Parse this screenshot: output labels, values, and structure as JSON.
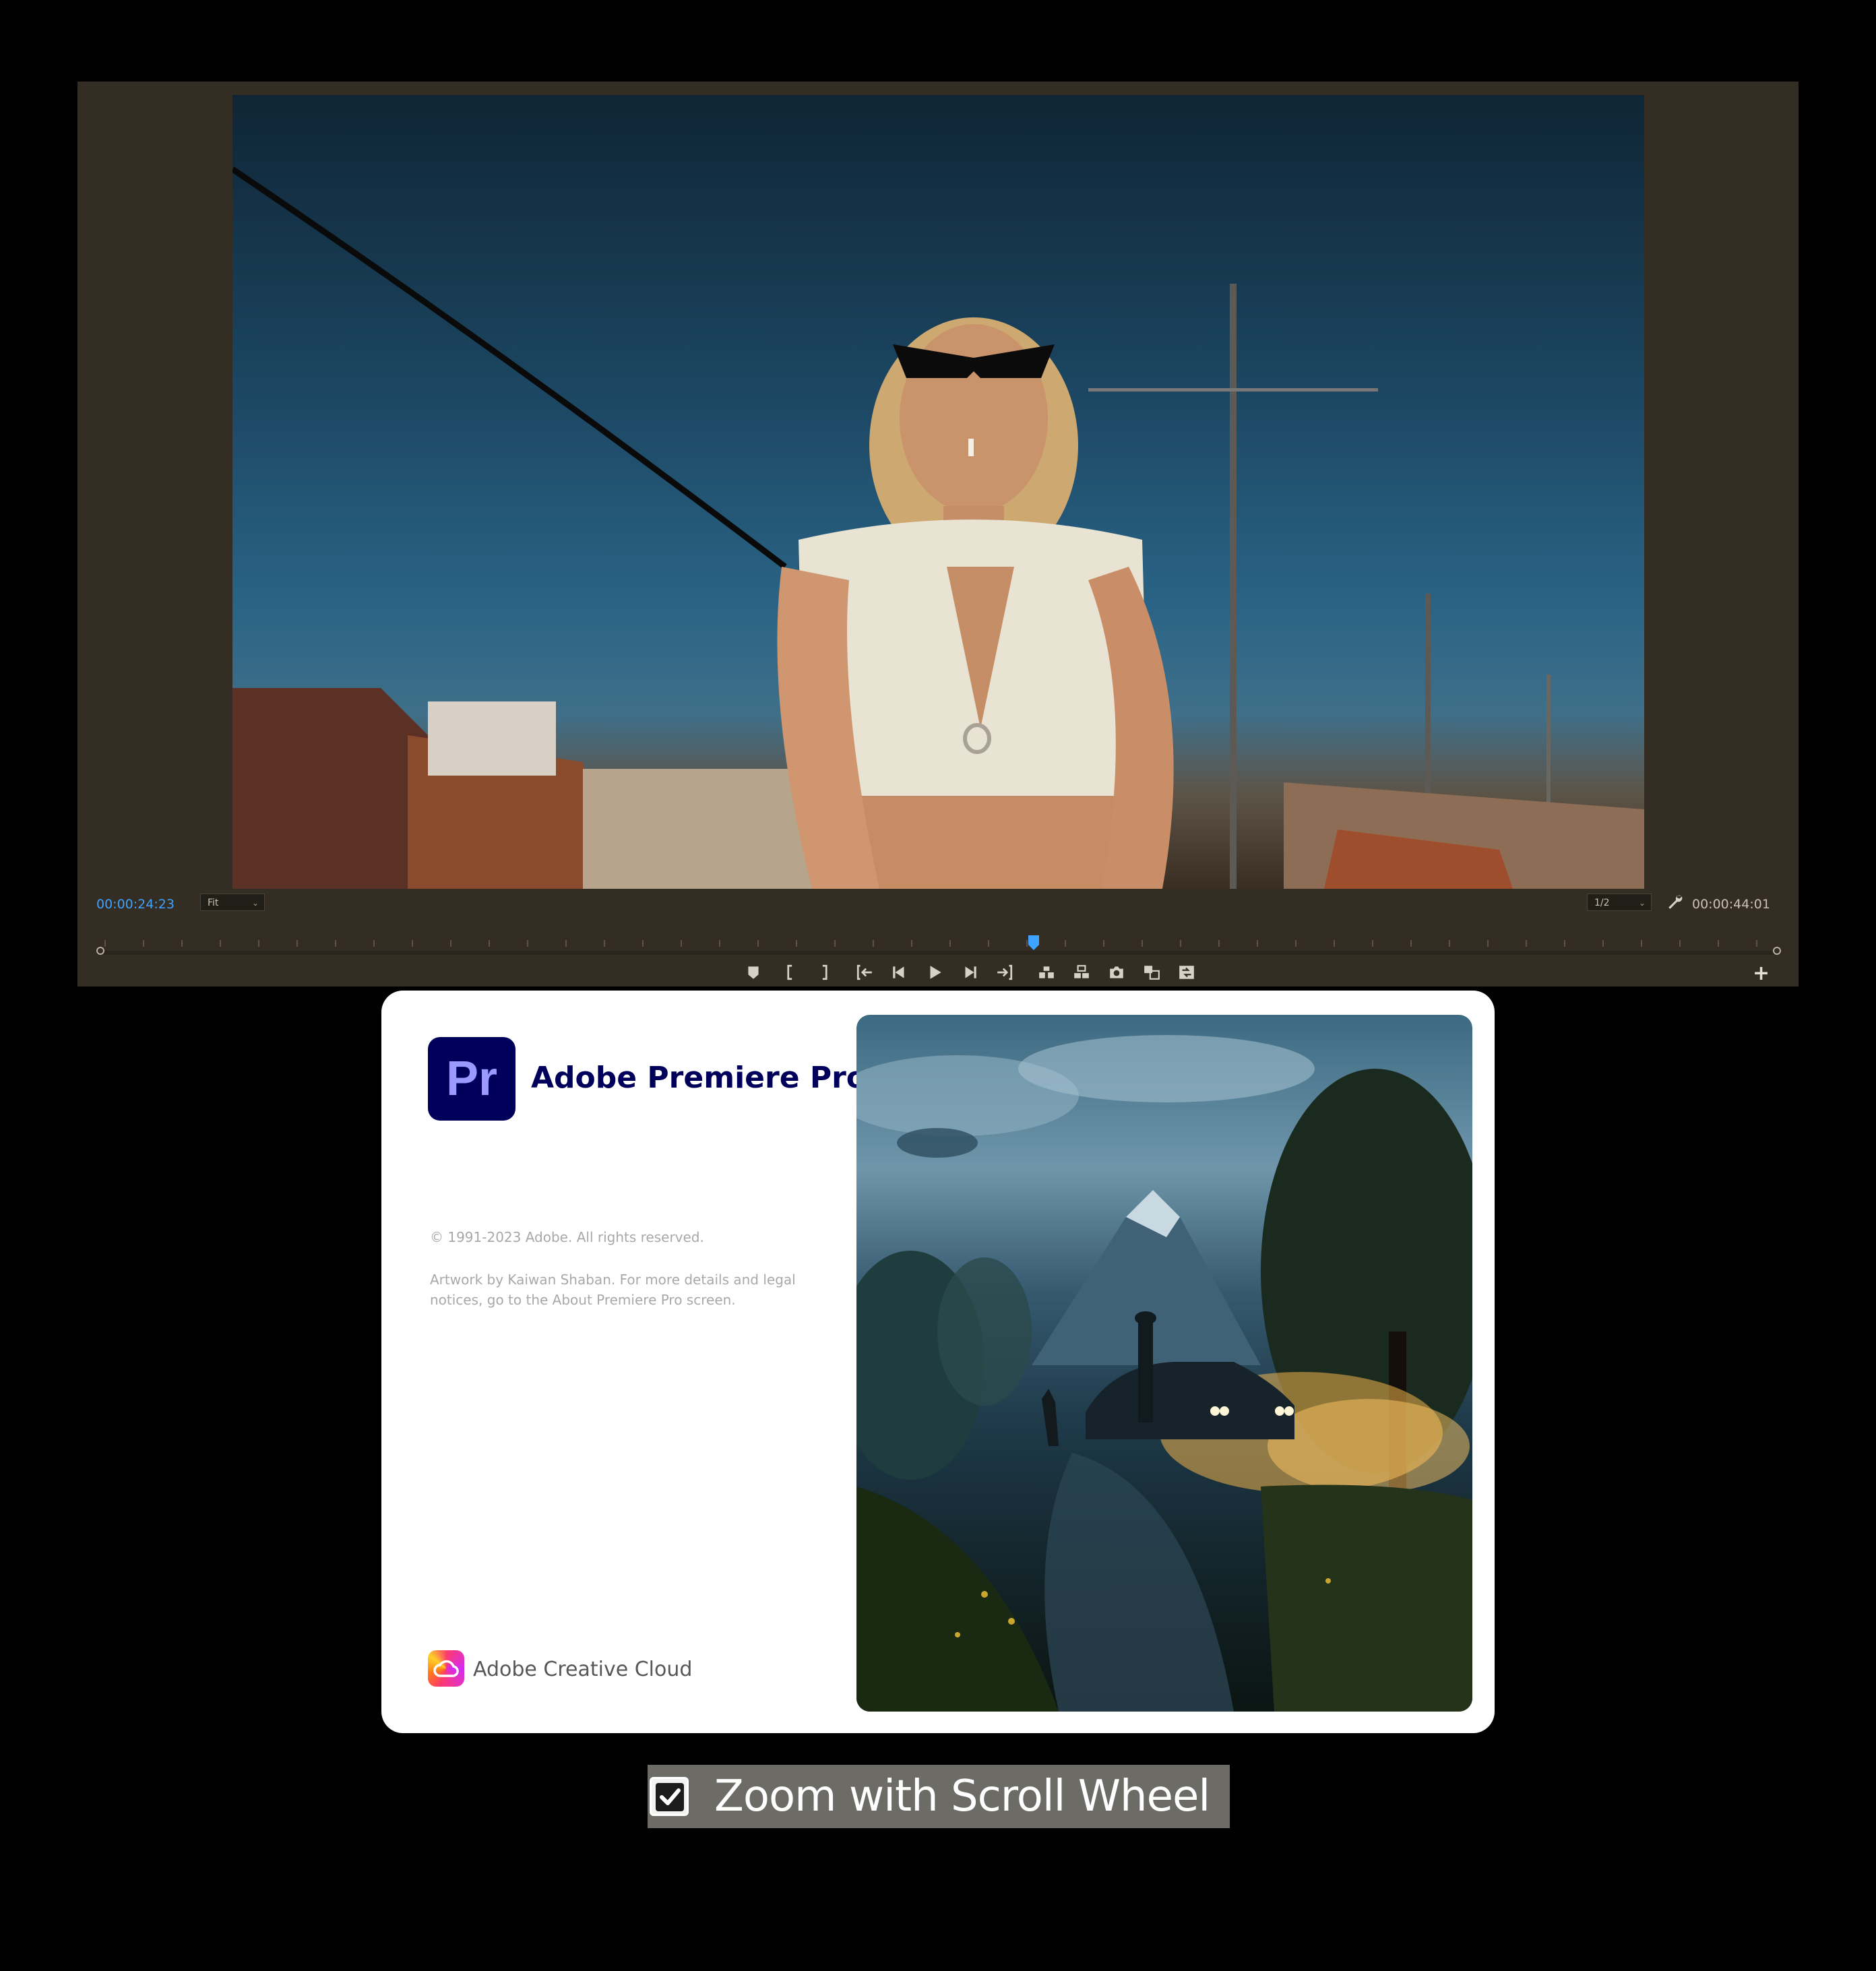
{
  "monitor": {
    "current_timecode": "00:00:24:23",
    "zoom_level": "Fit",
    "playback_resolution": "1/2",
    "duration_timecode": "00:00:44:01",
    "playhead_position": 0.5565,
    "accent_color": "#3ea3ff",
    "transport_buttons": [
      {
        "name": "add-marker-button",
        "icon": "marker-icon"
      },
      {
        "name": "mark-in-button",
        "icon": "mark-in-icon"
      },
      {
        "name": "mark-out-button",
        "icon": "mark-out-icon"
      },
      {
        "name": "go-to-in-button",
        "icon": "go-to-in-icon"
      },
      {
        "name": "step-back-button",
        "icon": "step-back-icon"
      },
      {
        "name": "play-button",
        "icon": "play-icon"
      },
      {
        "name": "step-forward-button",
        "icon": "step-forward-icon"
      },
      {
        "name": "go-to-out-button",
        "icon": "go-to-out-icon"
      },
      {
        "name": "lift-button",
        "icon": "lift-icon"
      },
      {
        "name": "extract-button",
        "icon": "extract-icon"
      },
      {
        "name": "export-frame-button",
        "icon": "camera-icon"
      },
      {
        "name": "comparison-view-button",
        "icon": "comparison-icon"
      },
      {
        "name": "proxy-toggle-button",
        "icon": "proxy-icon"
      }
    ]
  },
  "splash": {
    "logo_text": "Pr",
    "app_name": "Adobe Premiere Pro",
    "copyright": "© 1991-2023 Adobe. All rights reserved.",
    "artwork_credit": "Artwork by Kaiwan Shaban. For more details and legal notices, go to the About Premiere Pro screen.",
    "footer_brand": "Adobe Creative Cloud",
    "brand_color": "#00005b"
  },
  "option": {
    "label": "Zoom with Scroll Wheel",
    "checked": true
  }
}
